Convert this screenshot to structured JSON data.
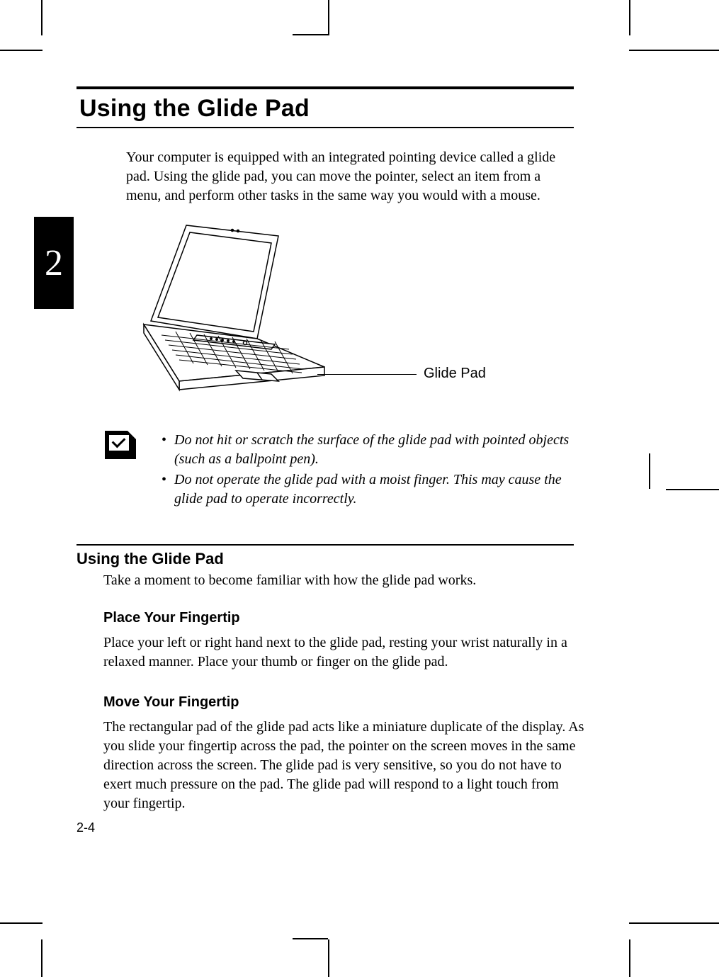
{
  "chapter_number": "2",
  "title": "Using the Glide Pad",
  "intro": "Your computer is equipped with an integrated pointing device called a glide pad.  Using the glide pad, you can move the pointer, select an item from a menu, and perform other tasks in the same way you would with a mouse.",
  "figure": {
    "callout_label": "Glide Pad"
  },
  "notes": [
    "Do not hit or scratch the surface of the glide pad with pointed objects (such as a ballpoint pen).",
    "Do not operate the glide pad with a moist finger. This may cause the glide pad to operate incorrectly."
  ],
  "section": {
    "heading": "Using the Glide Pad",
    "intro": "Take a moment to become familiar with how the glide pad works.",
    "subsections": [
      {
        "heading": "Place Your Fingertip",
        "body": "Place your left or right hand next to the glide pad, resting your wrist naturally in a relaxed manner. Place your thumb or finger on the glide pad."
      },
      {
        "heading": "Move Your Fingertip",
        "body": "The rectangular pad of the glide pad acts like a miniature duplicate of the display. As you slide your fingertip across the pad, the pointer on the screen moves in the same direction across the screen. The glide pad is very sensitive, so you do not have to exert much pressure on the pad. The glide pad will respond to a light touch from your fingertip."
      }
    ]
  },
  "page_number": "2-4"
}
